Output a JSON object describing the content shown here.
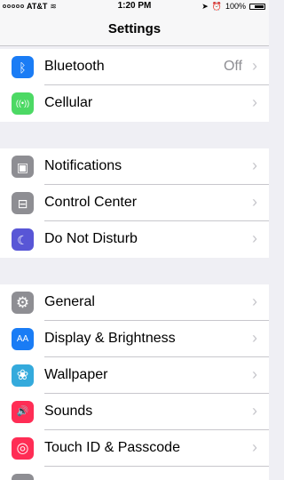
{
  "status_bar": {
    "carrier": "AT&T",
    "time": "1:20 PM",
    "battery": "100%"
  },
  "nav": {
    "title": "Settings"
  },
  "rows": [
    {
      "label": "Bluetooth",
      "value": "Off",
      "color": "#1a7cf5",
      "icon": "bluetooth-icon"
    },
    {
      "label": "Cellular",
      "color": "#4cd964",
      "icon": "antenna-icon"
    },
    {
      "label": "Notifications",
      "color": "#8e8e93",
      "icon": "notifications-icon"
    },
    {
      "label": "Control Center",
      "color": "#8e8e93",
      "icon": "control-center-icon"
    },
    {
      "label": "Do Not Disturb",
      "color": "#5856d6",
      "icon": "moon-icon"
    },
    {
      "label": "General",
      "color": "#8e8e93",
      "icon": "gear-icon"
    },
    {
      "label": "Display & Brightness",
      "color": "#1a7cf5",
      "icon": "text-size-icon"
    },
    {
      "label": "Wallpaper",
      "color": "#34aadc",
      "icon": "flower-icon"
    },
    {
      "label": "Sounds",
      "color": "#ff2d55",
      "icon": "speaker-icon"
    },
    {
      "label": "Touch ID & Passcode",
      "color": "#ff2d55",
      "icon": "fingerprint-icon"
    }
  ],
  "glyphs": {
    "bluetooth": "ᛒ",
    "cellular": "((•))",
    "notifications": "▣",
    "control_center": "⊟",
    "dnd": "☾",
    "general": "⚙",
    "display": "AA",
    "wallpaper": "❀",
    "sounds": "🔊",
    "touchid": "◎"
  },
  "chevron": "›"
}
